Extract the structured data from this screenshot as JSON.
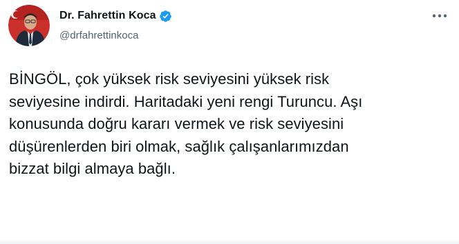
{
  "author": {
    "display_name": "Dr. Fahrettin Koca",
    "handle": "@drfahrettinkoca",
    "verified": true
  },
  "tweet": {
    "text": "BİNGÖL, çok yüksek risk seviyesini yüksek risk\nseviyesine indirdi. Haritadaki yeni rengi Turuncu. Aşı\nkonusunda doğru kararı vermek ve risk seviyesini\ndüşürenlerden biri olmak, sağlık çalışanlarımızdan\nbizzat bilgi almaya bağlı."
  },
  "icons": {
    "avatar": "profile-photo",
    "verified": "verified-badge-icon",
    "more": "more-options-icon"
  },
  "colors": {
    "text": "#0f1419",
    "secondary_text": "#536471",
    "verified_blue": "#1d9bf0",
    "background": "#ffffff"
  }
}
